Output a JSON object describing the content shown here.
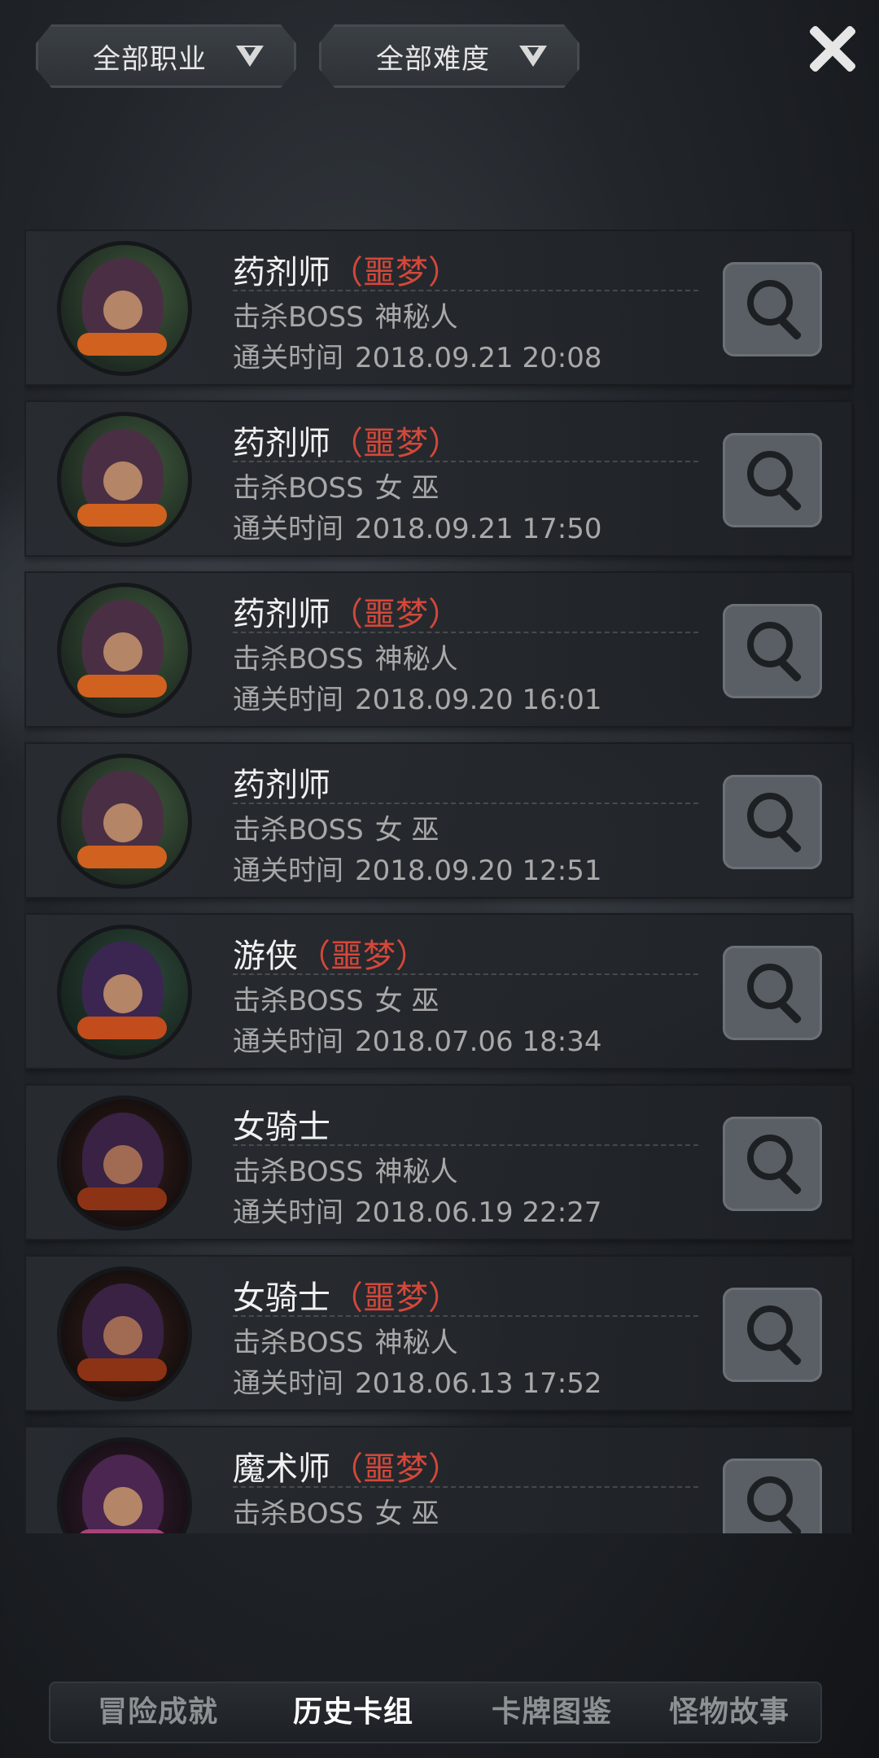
{
  "filters": {
    "profession": "全部职业",
    "difficulty": "全部难度"
  },
  "records": [
    {
      "name": "药剂师",
      "difficulty": "（噩梦）",
      "boss_label": "击杀BOSS",
      "boss": "神秘人",
      "time_label": "通关时间",
      "time": "2018.09.21 20:08",
      "avatar": "alchemist"
    },
    {
      "name": "药剂师",
      "difficulty": "（噩梦）",
      "boss_label": "击杀BOSS",
      "boss": "女 巫",
      "time_label": "通关时间",
      "time": "2018.09.21 17:50",
      "avatar": "alchemist"
    },
    {
      "name": "药剂师",
      "difficulty": "（噩梦）",
      "boss_label": "击杀BOSS",
      "boss": "神秘人",
      "time_label": "通关时间",
      "time": "2018.09.20 16:01",
      "avatar": "alchemist"
    },
    {
      "name": "药剂师",
      "difficulty": "",
      "boss_label": "击杀BOSS",
      "boss": "女 巫",
      "time_label": "通关时间",
      "time": "2018.09.20 12:51",
      "avatar": "alchemist"
    },
    {
      "name": "游侠",
      "difficulty": "（噩梦）",
      "boss_label": "击杀BOSS",
      "boss": "女 巫",
      "time_label": "通关时间",
      "time": "2018.07.06 18:34",
      "avatar": "ranger"
    },
    {
      "name": "女骑士",
      "difficulty": "",
      "boss_label": "击杀BOSS",
      "boss": "神秘人",
      "time_label": "通关时间",
      "time": "2018.06.19 22:27",
      "avatar": "knight"
    },
    {
      "name": "女骑士",
      "difficulty": "（噩梦）",
      "boss_label": "击杀BOSS",
      "boss": "神秘人",
      "time_label": "通关时间",
      "time": "2018.06.13 17:52",
      "avatar": "knight"
    },
    {
      "name": "魔术师",
      "difficulty": "（噩梦）",
      "boss_label": "击杀BOSS",
      "boss": "女 巫",
      "time_label": "",
      "time": "",
      "avatar": "magician"
    }
  ],
  "icons": {
    "filter_dropdown": "chevron-down-icon",
    "close": "close-icon",
    "view": "magnifier-icon"
  },
  "tabs": [
    {
      "label": "冒险成就",
      "active": false
    },
    {
      "label": "历史卡组",
      "active": true
    },
    {
      "label": "卡牌图鉴",
      "active": false
    },
    {
      "label": "怪物故事",
      "active": false
    }
  ],
  "colors": {
    "nightmare": "#d3483a",
    "background": "#22262b"
  }
}
